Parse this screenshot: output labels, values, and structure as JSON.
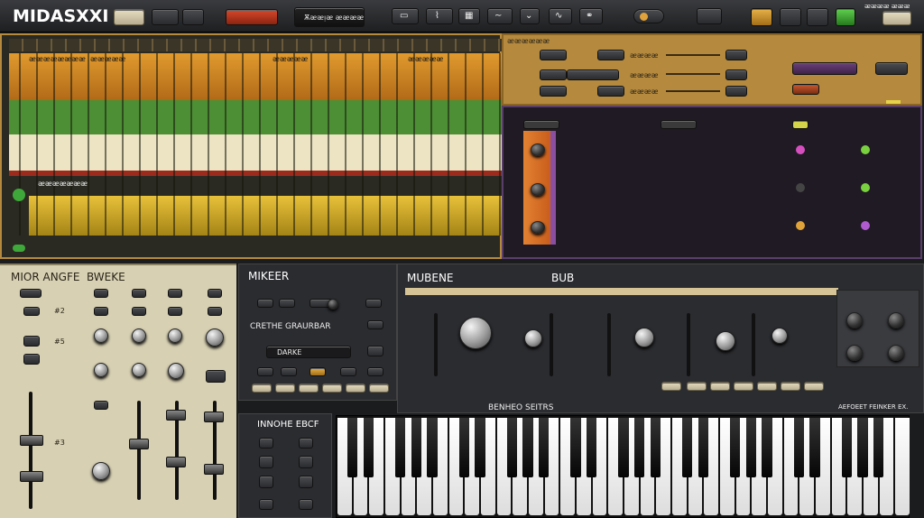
{
  "app": {
    "title": "MIDASXXI",
    "transport_label": "Ѫᴂᴂᴉᴂ ᴂᴂᴂᴂ",
    "colors": {
      "accent": "#e0a23a",
      "record": "#c2361f",
      "green": "#3fa83a",
      "track_green": "#4d8f35",
      "track_yellow": "#d8b12e",
      "panel_tan": "#b58a3e",
      "purple": "#8a4fa0"
    }
  },
  "toolbar": {
    "icons": [
      "play-icon",
      "stop-icon",
      "loop-icon",
      "bars-icon",
      "curve-icon",
      "chevron-icon",
      "wave-icon",
      "link-icon"
    ],
    "right_text": "ᴂᴂᴂᴂ ᴂᴂᴂ"
  },
  "arrangement": {
    "labels": [
      "ᴂᴂᴂᴂᴂᴂᴂᴂ",
      "ᴂᴂᴂᴂᴂ",
      "ᴂᴂᴂᴂᴂ",
      "ᴂᴂᴂᴂᴂ"
    ],
    "lower_label": "ᴂᴂᴂᴂᴂᴂᴂ"
  },
  "inspector": {
    "label": "ᴂᴂᴂᴂᴂᴂ",
    "rows": [
      "ᴂᴂᴂᴂ",
      "ᴂᴂᴂᴂ",
      "ᴂᴂᴂᴂ"
    ]
  },
  "mixer_left": {
    "title": "MIOR ANGFE",
    "sub": "BWEKE",
    "labels": [
      "#2",
      "#5",
      "#3"
    ]
  },
  "mixer": {
    "title": "MIKEER",
    "sub": "CRETHE GRAURBAR",
    "row": "DARKE"
  },
  "synth": {
    "title": "MUBENE",
    "sub": "BUB",
    "footer": "BENHEO SEITRS",
    "right_footer": "AEFOEET FEINKER EX."
  },
  "keyboard": {
    "label": "INNOHE EBCF"
  }
}
